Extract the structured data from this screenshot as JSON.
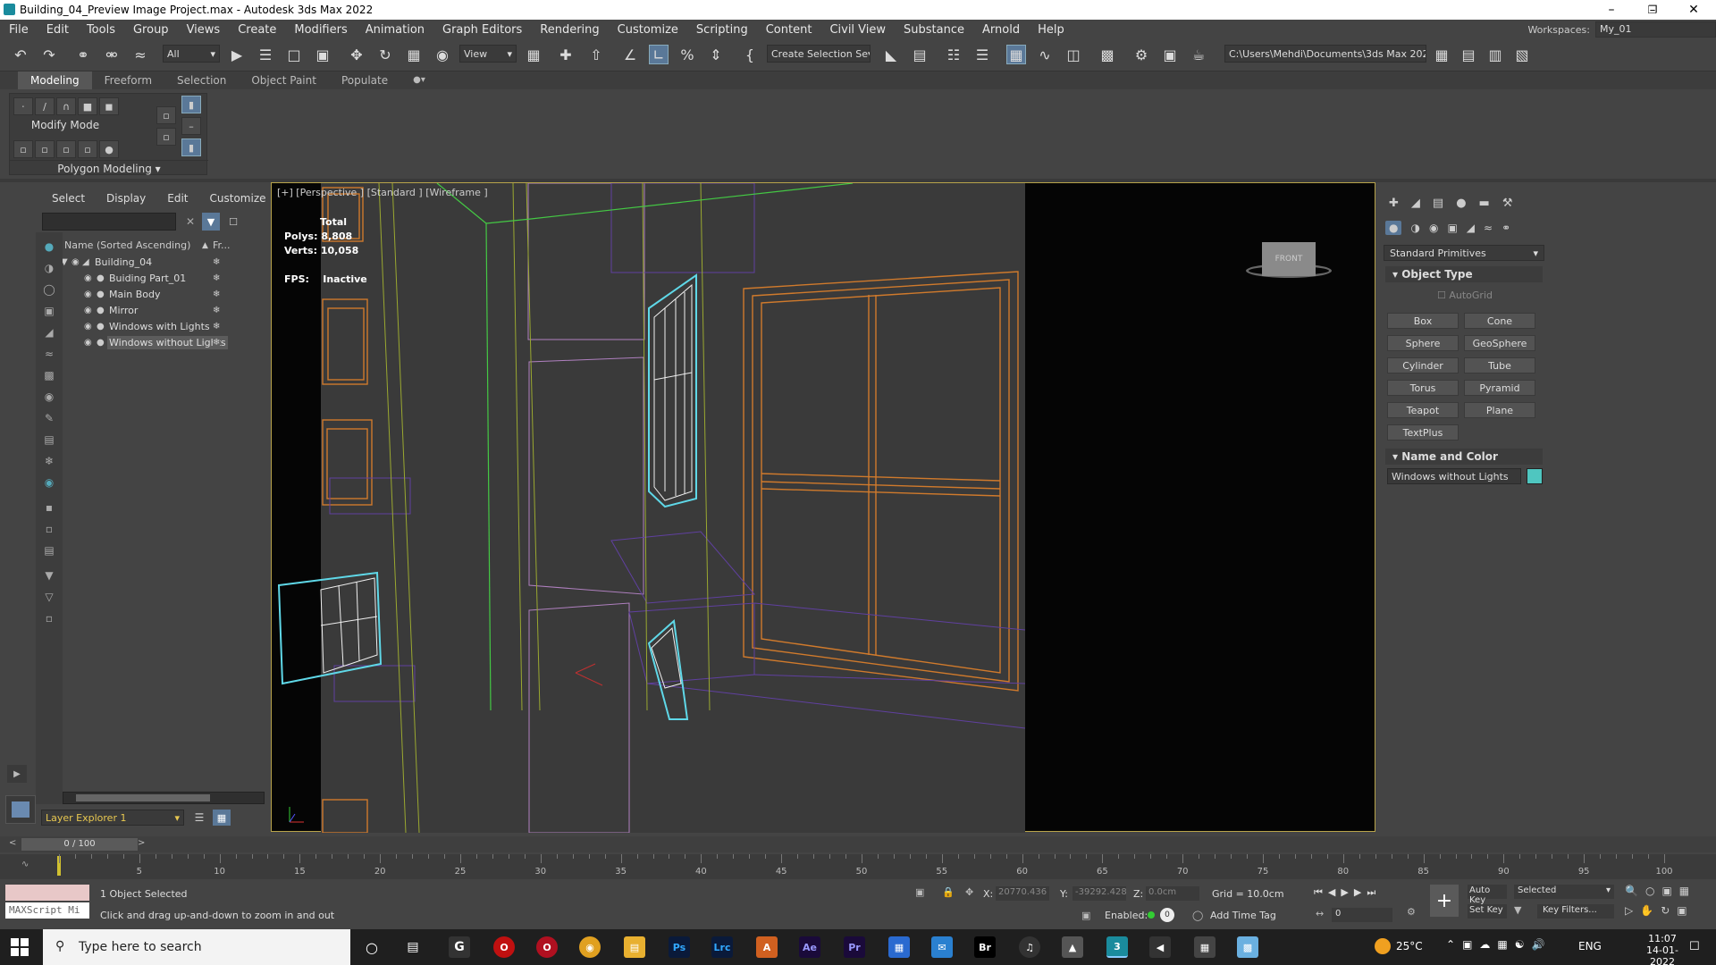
{
  "window": {
    "title": "Building_04_Preview Image Project.max - Autodesk 3ds Max 2022"
  },
  "menu": [
    "File",
    "Edit",
    "Tools",
    "Group",
    "Views",
    "Create",
    "Modifiers",
    "Animation",
    "Graph Editors",
    "Rendering",
    "Customize",
    "Scripting",
    "Content",
    "Civil View",
    "Substance",
    "Arnold",
    "Help"
  ],
  "workspace": {
    "label": "Workspaces:",
    "value": "My_01"
  },
  "toolbar": {
    "selection_filter": "All",
    "ref_coord": "View",
    "named_selection": "Create Selection Se",
    "project_path": "C:\\Users\\Mehdi\\Documents\\3ds Max 2022"
  },
  "ribbon": {
    "tabs": [
      "Modeling",
      "Freeform",
      "Selection",
      "Object Paint",
      "Populate"
    ],
    "mode": "Modify Mode",
    "panel": "Polygon Modeling"
  },
  "scene_explorer": {
    "tabs": [
      "Select",
      "Display",
      "Edit",
      "Customize"
    ],
    "column": "Name (Sorted Ascending)",
    "column2": "Fr...",
    "root": "Building_04",
    "items": [
      "Buiding Part_01",
      "Main Body",
      "Mirror",
      "Windows with Lights",
      "Windows without Lights"
    ],
    "selected_index": 4,
    "layer": "Layer Explorer 1"
  },
  "viewport": {
    "label": "[+] [Perspective ] [Standard ] [Wireframe ]",
    "stats": {
      "total": "Total",
      "polys_label": "Polys:",
      "polys": "8,808",
      "verts_label": "Verts:",
      "verts": "10,058",
      "fps_label": "FPS:",
      "fps": "Inactive"
    },
    "viewcube": "FRONT"
  },
  "command_panel": {
    "category": "Standard Primitives",
    "object_type_title": "Object Type",
    "autogrid": "AutoGrid",
    "buttons": [
      "Box",
      "Cone",
      "Sphere",
      "GeoSphere",
      "Cylinder",
      "Tube",
      "Torus",
      "Pyramid",
      "Teapot",
      "Plane",
      "TextPlus"
    ],
    "name_color_title": "Name and Color",
    "object_name": "Windows without Lights",
    "object_color": "#4fc6c0"
  },
  "timeline": {
    "frame": "0 / 100",
    "ticks": [
      "5",
      "10",
      "15",
      "20",
      "25",
      "30",
      "35",
      "40",
      "45",
      "50",
      "55",
      "60",
      "65",
      "70",
      "75",
      "80",
      "85",
      "90",
      "95",
      "100"
    ]
  },
  "status": {
    "selected": "1 Object Selected",
    "prompt": "Click and drag up-and-down to zoom in and out",
    "maxscript": "MAXScript Mi",
    "x_label": "X:",
    "x": "20770.436",
    "y_label": "Y:",
    "y": "-39292.428",
    "z_label": "Z:",
    "z": "0.0cm",
    "grid": "Grid = 10.0cm",
    "enabled": "Enabled:",
    "add_time_tag": "Add Time Tag",
    "auto_key": "Auto Key",
    "set_key": "Set Key",
    "key_mode": "Selected",
    "key_filters": "Key Filters...",
    "current_frame": "0"
  },
  "taskbar": {
    "search": "Type here to search",
    "temp": "25°C",
    "lang": "ENG",
    "time": "11:07",
    "date": "14-01-2022"
  }
}
